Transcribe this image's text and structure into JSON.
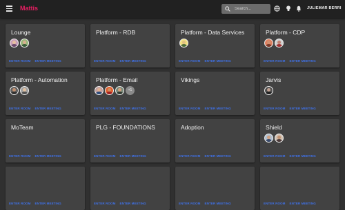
{
  "app": {
    "title": "Mattis"
  },
  "search": {
    "placeholder": "Search..."
  },
  "user": {
    "name": "JULIEMAR BERRI"
  },
  "colors": {
    "accent": "#e91e63",
    "link": "#3f71e8",
    "card": "#424242",
    "background": "#303030",
    "topbar": "#212121"
  },
  "actions": {
    "enter_room": "ENTER ROOM",
    "enter_meeting": "ENTER MEETING"
  },
  "rooms": [
    {
      "title": "Lounge",
      "avatars": [
        {
          "bg": "#c9a0b8",
          "face": "#e8c0a0",
          "body": "#6a4a6a"
        },
        {
          "bg": "#9ab87a",
          "face": "#d8b090",
          "body": "#3a5a3a"
        }
      ]
    },
    {
      "title": "Platform - RDB",
      "avatars": []
    },
    {
      "title": "Platform - Data Services",
      "avatars": [
        {
          "bg": "#f0e080",
          "face": "#e0c080",
          "body": "#4a6a3a"
        }
      ]
    },
    {
      "title": "Platform - CDP",
      "avatars": [
        {
          "bg": "#e08060",
          "face": "#d09070",
          "body": "#7a3a2a"
        },
        {
          "bg": "#d0d0d0",
          "face": "#c08070",
          "body": "#a03030"
        }
      ]
    },
    {
      "title": "Platform - Automation",
      "avatars": [
        {
          "bg": "#606060",
          "face": "#c09070",
          "body": "#303030"
        },
        {
          "bg": "#a0a0a0",
          "face": "#e0c0a0",
          "body": "#505050"
        }
      ]
    },
    {
      "title": "Platform - Email",
      "avatars": [
        {
          "bg": "#c0a0a0",
          "face": "#e0b090",
          "body": "#2a4a7a"
        },
        {
          "bg": "#e06030",
          "face": "#d09060",
          "body": "#a02020"
        },
        {
          "bg": "#7a8a7a",
          "face": "#d0a080",
          "body": "#303a30"
        }
      ],
      "more": "+1"
    },
    {
      "title": "Vikings",
      "avatars": []
    },
    {
      "title": "Jarvis",
      "avatars": [
        {
          "bg": "#505050",
          "face": "#c0a090",
          "body": "#202020"
        }
      ]
    },
    {
      "title": "MoTeam",
      "avatars": []
    },
    {
      "title": "PLG - FOUNDATIONS",
      "avatars": []
    },
    {
      "title": "Adoption",
      "avatars": []
    },
    {
      "title": "Shield",
      "avatars": [
        {
          "bg": "#b0c0d0",
          "face": "#d0a080",
          "body": "#3a4a6a"
        },
        {
          "bg": "#d0c0b0",
          "face": "#c09070",
          "body": "#4a3a3a"
        }
      ]
    },
    {
      "title": "",
      "avatars": []
    },
    {
      "title": "",
      "avatars": []
    },
    {
      "title": "",
      "avatars": []
    },
    {
      "title": "",
      "avatars": []
    }
  ]
}
